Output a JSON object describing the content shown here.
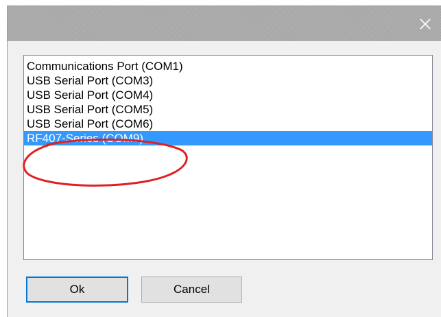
{
  "window": {
    "close_icon": "close-icon"
  },
  "ports": {
    "items": [
      {
        "label": "Communications Port (COM1)",
        "selected": false
      },
      {
        "label": "USB Serial Port (COM3)",
        "selected": false
      },
      {
        "label": "USB Serial Port (COM4)",
        "selected": false
      },
      {
        "label": "USB Serial Port (COM5)",
        "selected": false
      },
      {
        "label": "USB Serial Port (COM6)",
        "selected": false
      },
      {
        "label": "RF407-Series (COM9)",
        "selected": true
      }
    ]
  },
  "buttons": {
    "ok_label": "Ok",
    "cancel_label": "Cancel"
  },
  "colors": {
    "selection": "#3399ff",
    "annotation": "#e02020",
    "default_button_border": "#0078d7"
  }
}
